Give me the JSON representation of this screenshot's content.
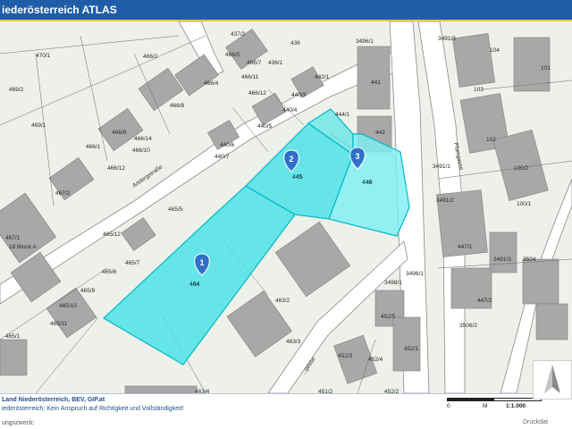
{
  "app": {
    "title": "iederösterreich ATLAS"
  },
  "map": {
    "colors": {
      "background": "#eef0ea",
      "building": "#a8a8a8",
      "road": "#ffffff",
      "parcel_line": "#6a6a6a",
      "selection_fill": "#3fe2e6",
      "selection_stroke": "#00b9c8",
      "marker": "#2f6fc9"
    },
    "road_labels": {
      "anderstrasse": "Andergstraße",
      "pfarrgasse": "Pfarrgasse",
      "lower_road": "...gasse"
    },
    "parcel_labels": [
      "437/2",
      "436",
      "3496/1",
      "3491/3",
      "104",
      "470/1",
      "466/2",
      "466/5",
      "466/7",
      "466/4",
      "436/1",
      "442/1",
      "441",
      "101",
      "469/2",
      "466/8",
      "466/11",
      "466/12",
      "440/3",
      "440/4",
      "444/1",
      "103",
      "469/1",
      "466/9",
      "466/14",
      "440/5",
      "442",
      "102",
      "466/1",
      "466/10",
      "440/6",
      "440/7",
      "3491/1",
      "100/2",
      "466/12",
      "445",
      "446",
      "467/2",
      "465/5",
      "3491/2",
      "100/1",
      "447/1",
      "467/1",
      "18 Block A",
      "465/12",
      "3491/3",
      "3504",
      "465/7",
      "465/6",
      "464",
      "3496/1",
      "3498/1",
      "465/9",
      "463/2",
      "465/10",
      "447/2",
      "465/11",
      "452/5",
      "465/1",
      "452/1",
      "463/3",
      "3506/2",
      "452/3",
      "452/4",
      "463/4",
      "451/2",
      "452/2"
    ],
    "parcel_numbers": {
      "p1": "464",
      "p2": "445",
      "p3": "446"
    },
    "markers": [
      {
        "id": "1",
        "label": "1"
      },
      {
        "id": "2",
        "label": "2"
      },
      {
        "id": "3",
        "label": "3"
      }
    ]
  },
  "footer": {
    "copyright": "Land Niederösterreich, BEV, GIP.at",
    "disclaimer": "iederösterreich: Kein Anspruch auf Richtigkeit und Vollständigkeit!",
    "purpose": "ungszweck:",
    "scale_zero": "0",
    "scale_length": "M",
    "scale_ratio": "1:1.000",
    "print_label": "Druckdat"
  }
}
